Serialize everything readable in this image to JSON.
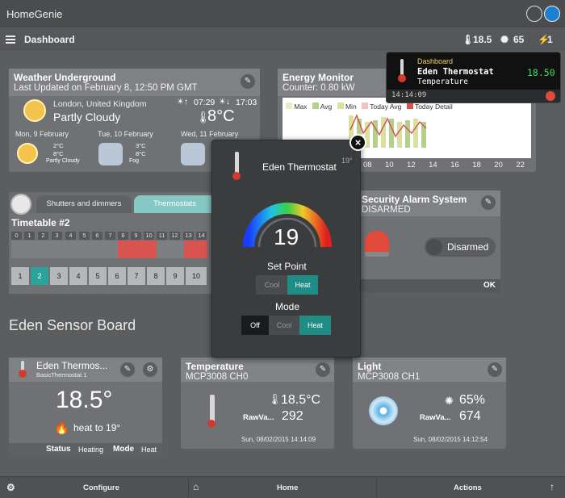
{
  "app": {
    "title": "HomeGenie"
  },
  "header": {
    "title": "Dashboard",
    "temperature": "18.5",
    "luminance": "65",
    "power": "1"
  },
  "weather": {
    "title": "Weather Underground",
    "last_updated": "Last Updated on February 8, 12:50 PM GMT",
    "location": "London, United Kingdom",
    "condition": "Partly Cloudy",
    "sunrise": "07:29",
    "sunset": "17:03",
    "temperature": "8°C",
    "forecast": [
      {
        "day": "Mon, 9 February",
        "high": "2°C",
        "low": "8°C",
        "condition": "Partly Cloudy"
      },
      {
        "day": "Tue, 10 February",
        "high": "3°C",
        "low": "8°C",
        "condition": "Fog"
      },
      {
        "day": "Wed, 11 February"
      }
    ]
  },
  "energy": {
    "title": "Energy Monitor",
    "counter": "Counter: 0.80 kW",
    "legend": [
      "Max",
      "Avg",
      "Min",
      "Today Avg",
      "Today Detail"
    ],
    "x_ticks": [
      "08",
      "10",
      "12",
      "14",
      "16",
      "18",
      "20",
      "22"
    ],
    "legend_colors": {
      "max": "#e5efc4",
      "avg": "#b5d08a",
      "min": "#d8e29e",
      "today_avg": "#f4c2c2",
      "today_detail": "#d9534f"
    }
  },
  "shutters": {
    "tabs": [
      "Shutters and dimmers",
      "Thermostats"
    ],
    "timetable_title": "Timetable #2",
    "hours": [
      "0",
      "1",
      "2",
      "3",
      "4",
      "5",
      "6",
      "7",
      "8",
      "9",
      "10",
      "11",
      "12",
      "13",
      "14"
    ],
    "pages": [
      "1",
      "2",
      "3",
      "4",
      "5",
      "6",
      "7",
      "8",
      "9",
      "10"
    ]
  },
  "alarm": {
    "title": "Security Alarm System",
    "status": "DISARMED",
    "toggle_label": "Disarmed",
    "ok": "OK"
  },
  "section_title": "Eden Sensor Board",
  "thermostat_widget": {
    "title": "Eden Thermos...",
    "subtitle": "BasicThermostat 1",
    "value": "18.5°",
    "heat_to": "heat to 19°",
    "status_label": "Status",
    "status_value": "Heating",
    "mode_label": "Mode",
    "mode_value": "Heat"
  },
  "temperature_widget": {
    "title": "Temperature",
    "subtitle": "MCP3008 CH0",
    "value": "18.5°C",
    "raw_label": "RawVa...",
    "raw_value": "292",
    "timestamp": "Sun, 08/02/2015 14:14:09"
  },
  "light_widget": {
    "title": "Light",
    "subtitle": "MCP3008 CH1",
    "value": "65%",
    "raw_label": "RawVa...",
    "raw_value": "674",
    "timestamp": "Sun, 08/02/2015 14:12:54"
  },
  "popup": {
    "title": "Eden Thermostat",
    "corner": "19°",
    "setpoint": "19",
    "setpoint_label": "Set Point",
    "setpoint_options": [
      "Cool",
      "Heat"
    ],
    "mode_label": "Mode",
    "mode_options": [
      "Off",
      "Cool",
      "Heat"
    ]
  },
  "toast": {
    "category": "Dashboard",
    "device": "Eden Thermostat",
    "property": "Temperature",
    "value": "18.50",
    "time": "14:14:09"
  },
  "footer": {
    "configure": "Configure",
    "home": "Home",
    "actions": "Actions"
  },
  "colors": {
    "accent": "#2aa39b",
    "heat_active": "#1f8c86",
    "timetable_active": "#d9534f"
  }
}
